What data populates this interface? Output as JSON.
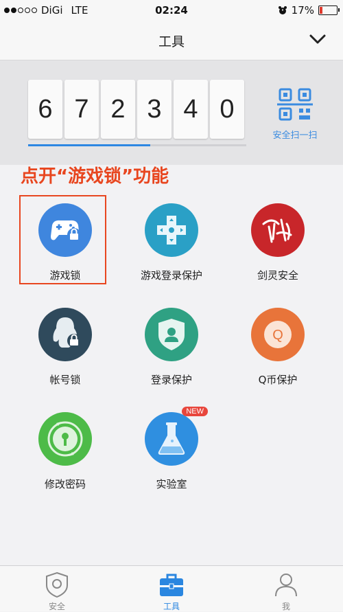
{
  "status_bar": {
    "carrier": "DiGi",
    "network": "LTE",
    "time": "02:24",
    "battery": "17%"
  },
  "header": {
    "title": "工具"
  },
  "token": {
    "digits": [
      "6",
      "7",
      "2",
      "3",
      "4",
      "0"
    ],
    "progress": 0.56,
    "scan_label": "安全扫一扫"
  },
  "annotation": "点开“游戏锁”功能",
  "tools": [
    {
      "label": "游戏锁",
      "icon": "gamepad-lock-icon",
      "color": "#3f86de"
    },
    {
      "label": "游戏登录保护",
      "icon": "game-controller-icon",
      "color": "#2aa0c6"
    },
    {
      "label": "剑灵安全",
      "icon": "blade-soul-logo-icon",
      "color": "#c8262a"
    },
    {
      "label": "帐号锁",
      "icon": "account-lock-icon",
      "color": "#2f4a5c"
    },
    {
      "label": "登录保护",
      "icon": "shield-user-icon",
      "color": "#2fa183"
    },
    {
      "label": "Q币保护",
      "icon": "q-coin-icon",
      "color": "#e8743a"
    },
    {
      "label": "修改密码",
      "icon": "keyhole-icon",
      "color": "#4dbb48"
    },
    {
      "label": "实验室",
      "icon": "flask-icon",
      "color": "#2f8fe0",
      "badge": "NEW"
    }
  ],
  "tabs": [
    {
      "label": "安全",
      "icon": "shield-tab-icon",
      "active": false
    },
    {
      "label": "工具",
      "icon": "toolbox-tab-icon",
      "active": true
    },
    {
      "label": "我",
      "icon": "person-tab-icon",
      "active": false
    }
  ],
  "colors": {
    "accent": "#2d87e2",
    "annotation": "#e8461f"
  }
}
